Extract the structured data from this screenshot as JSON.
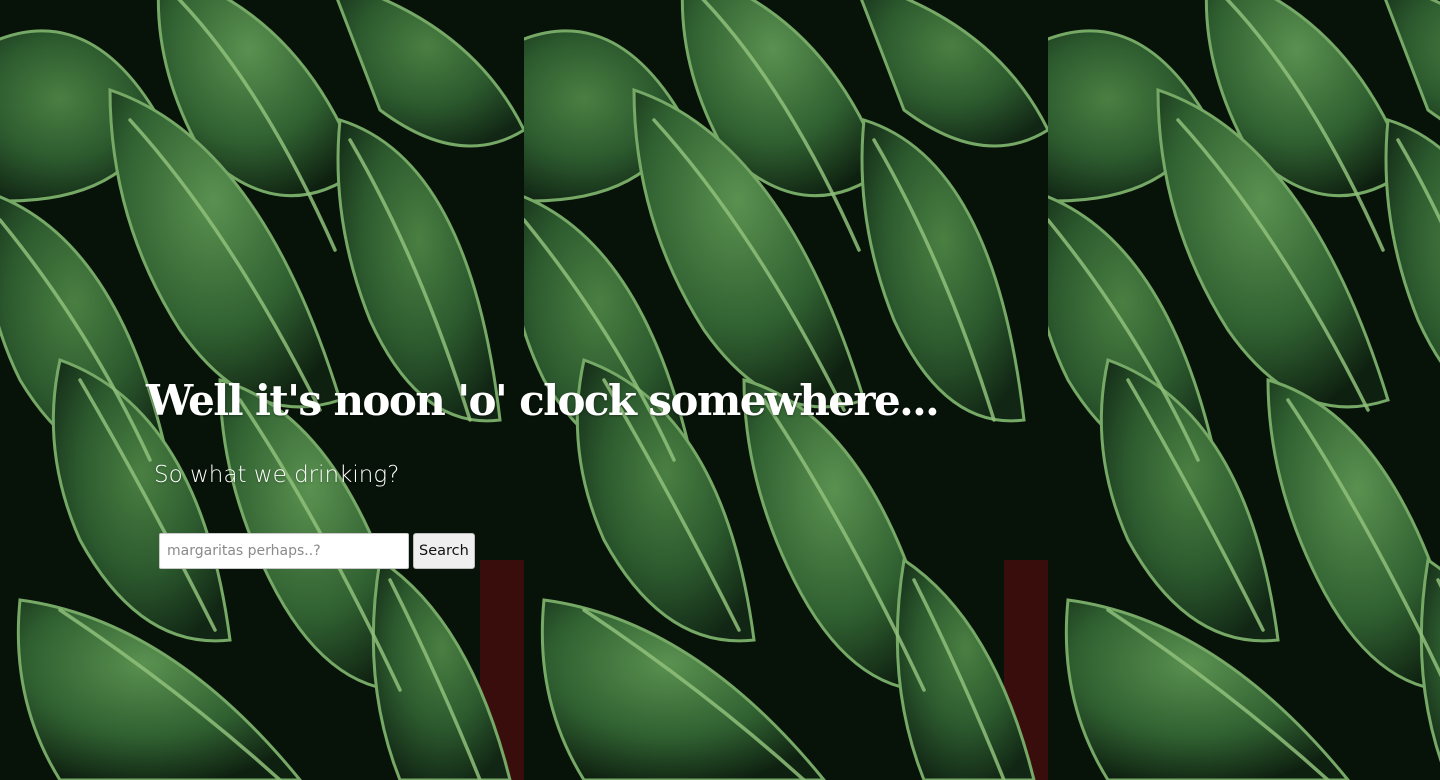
{
  "hero": {
    "headline": "Well it's noon 'o' clock somewhere...",
    "subheadline": "So what we drinking?"
  },
  "search": {
    "placeholder": "margaritas perhaps..?",
    "value": "",
    "button_label": "Search"
  },
  "colors": {
    "text": "#ffffff",
    "leaf_dark": "#1f3a22",
    "leaf_mid": "#2e5a30",
    "leaf_light": "#4f8a45",
    "shadow": "#050c06",
    "accent_red": "#4a0f0f"
  }
}
